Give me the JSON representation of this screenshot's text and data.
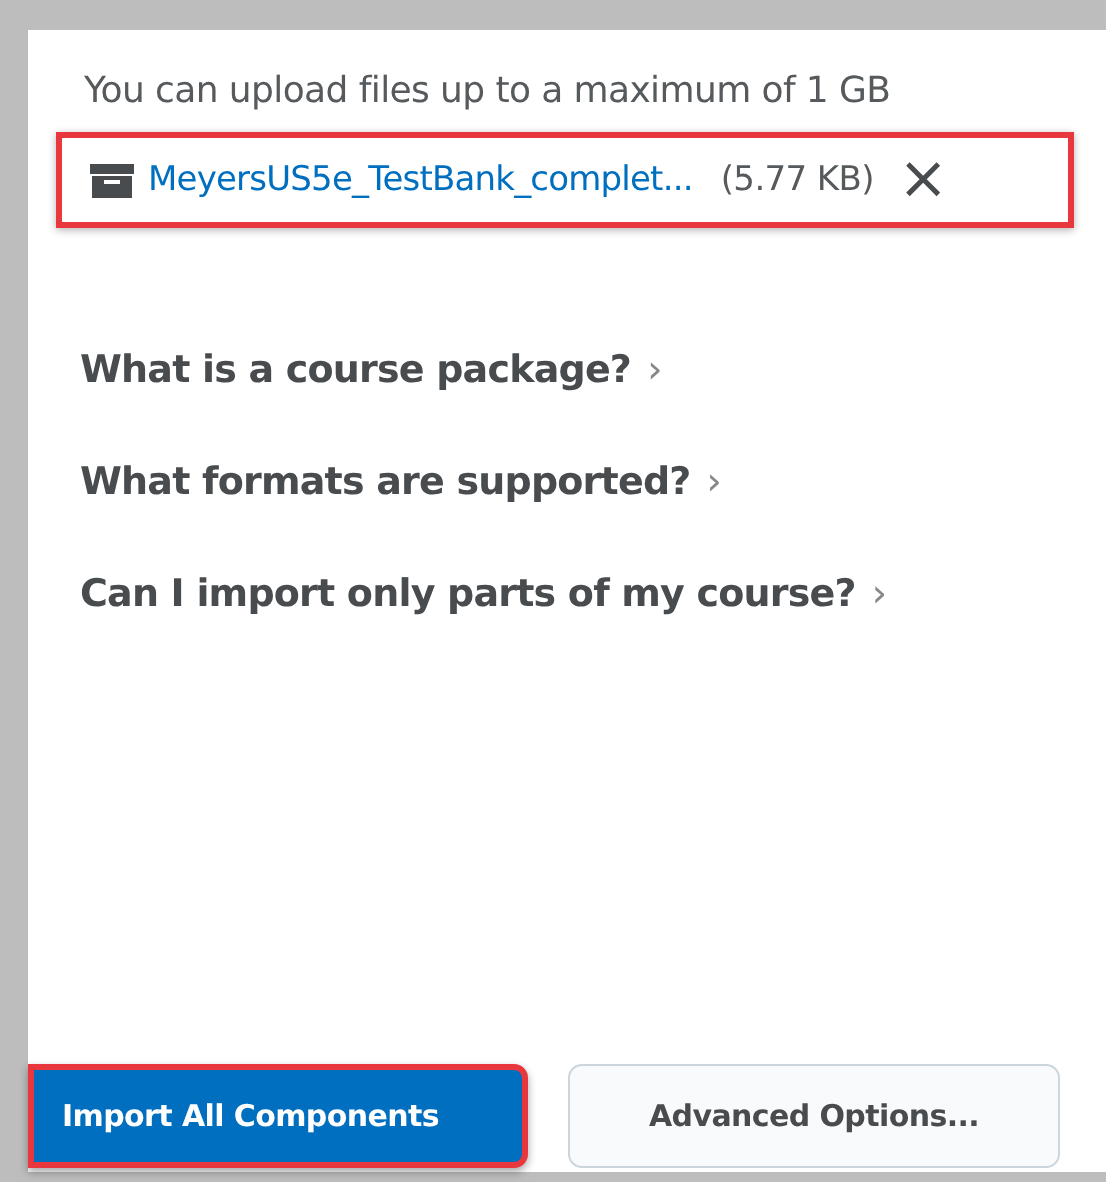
{
  "upload_note": "You can upload files up to a maximum of 1 GB",
  "file": {
    "name": "MeyersUS5e_TestBank_complet...",
    "size": "(5.77 KB)",
    "remove": "×",
    "highlighted": true
  },
  "help_links": [
    {
      "label": "What is a course package?",
      "chevron": "›"
    },
    {
      "label": "What formats are supported?",
      "chevron": "›"
    },
    {
      "label": "Can I import only parts of my course?",
      "chevron": "›"
    }
  ],
  "buttons": [
    {
      "label": "Import All Components",
      "kind": "primary",
      "highlighted": true
    },
    {
      "label": "Advanced Options...",
      "kind": "secondary",
      "highlighted": false
    }
  ]
}
